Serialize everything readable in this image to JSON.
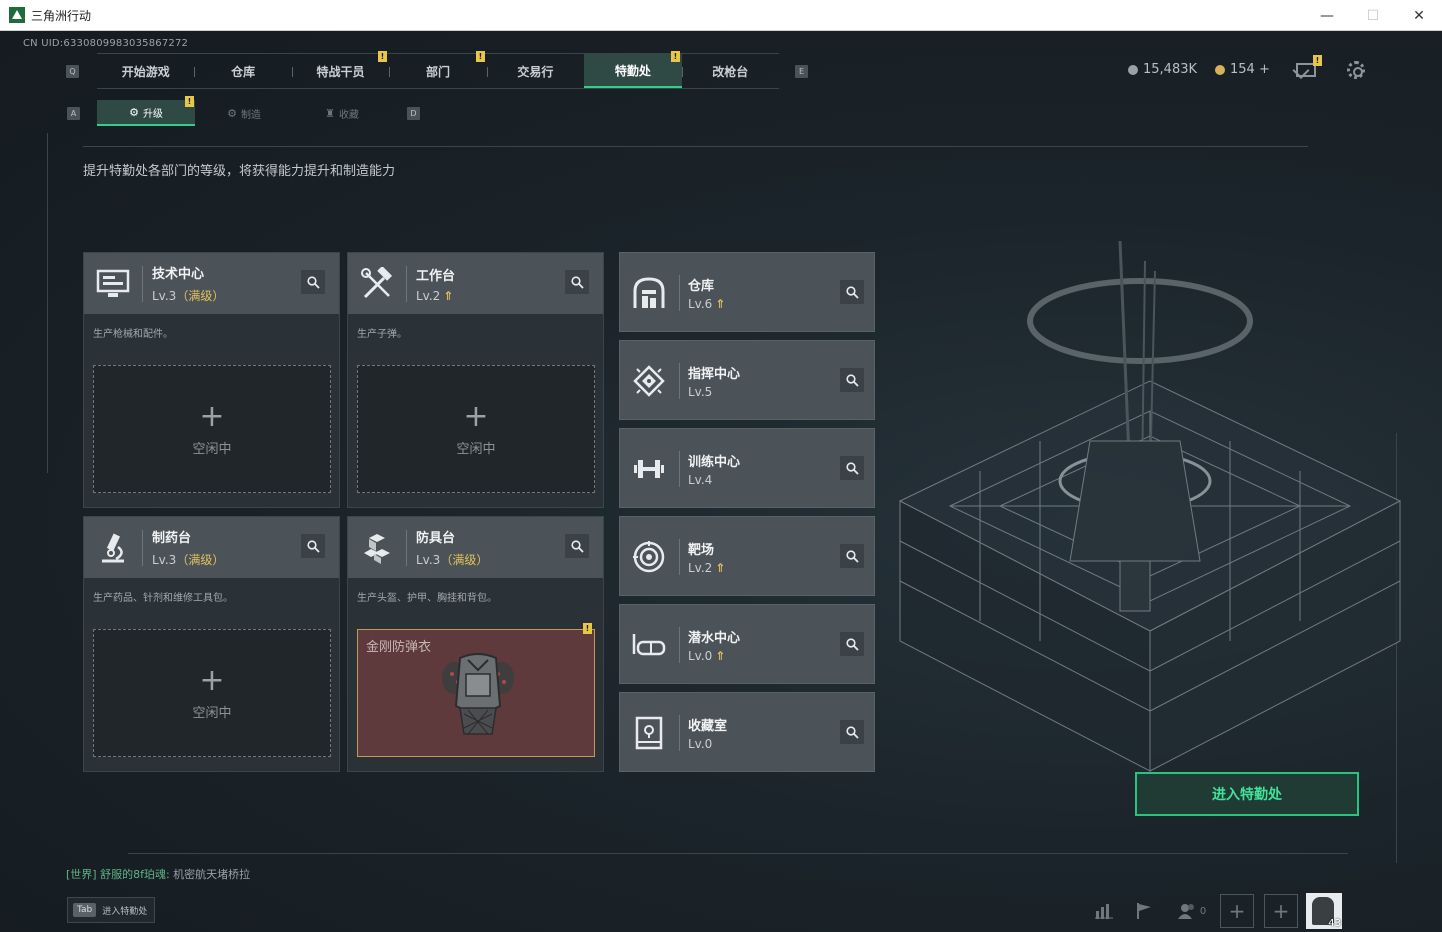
{
  "window": {
    "title": "三角洲行动",
    "minimize": "—",
    "maximize": "☐",
    "close": "✕"
  },
  "uid": "CN UID:6330809983035867272",
  "topnav": {
    "left_key": "Q",
    "right_key": "E",
    "tabs": [
      {
        "label": "开始游戏",
        "active": false,
        "badge": false
      },
      {
        "label": "仓库",
        "active": false,
        "badge": false
      },
      {
        "label": "特战干员",
        "active": false,
        "badge": true
      },
      {
        "label": "部门",
        "active": false,
        "badge": true
      },
      {
        "label": "交易行",
        "active": false,
        "badge": false
      },
      {
        "label": "特勤处",
        "active": true,
        "badge": true
      },
      {
        "label": "改枪台",
        "active": false,
        "badge": false
      }
    ]
  },
  "currency": {
    "silver": "15,483K",
    "gold": "154 +"
  },
  "badge_mark": "!",
  "subnav": {
    "left_key": "A",
    "right_key": "D",
    "tabs": [
      {
        "label": "升级",
        "icon": "⚙",
        "active": true
      },
      {
        "label": "制造",
        "icon": "⚙",
        "active": false
      },
      {
        "label": "收藏",
        "icon": "♜",
        "active": false
      }
    ]
  },
  "description": "提升特勤处各部门的等级，将获得能力提升和制造能力",
  "departments": [
    {
      "name": "技术中心",
      "level": "Lv.3",
      "maxed": "（满级）",
      "desc": "生产枪械和配件。",
      "slot_plus": "+",
      "slot_status": "空闲中"
    },
    {
      "name": "工作台",
      "level": "Lv.2",
      "upgrade": "⇑",
      "desc": "生产子弹。",
      "slot_plus": "+",
      "slot_status": "空闲中"
    },
    {
      "name": "制药台",
      "level": "Lv.3",
      "maxed": "（满级）",
      "desc": "生产药品、针剂和维修工具包。",
      "slot_plus": "+",
      "slot_status": "空闲中"
    },
    {
      "name": "防具台",
      "level": "Lv.3",
      "maxed": "（满级）",
      "desc": "生产头盔、护甲、胸挂和背包。",
      "item_name": "金刚防弹衣"
    }
  ],
  "right_departments": [
    {
      "name": "仓库",
      "level": "Lv.6",
      "upgrade": "⇑"
    },
    {
      "name": "指挥中心",
      "level": "Lv.5"
    },
    {
      "name": "训练中心",
      "level": "Lv.4"
    },
    {
      "name": "靶场",
      "level": "Lv.2",
      "upgrade": "⇑"
    },
    {
      "name": "潜水中心",
      "level": "Lv.0",
      "upgrade": "⇑"
    },
    {
      "name": "收藏室",
      "level": "Lv.0"
    }
  ],
  "enter_button": "进入特勤处",
  "chat": {
    "channel": "[世界]",
    "sender": "舒服的8f珀魂:",
    "message": "机密航天堵桥拉"
  },
  "tab_hint": {
    "key": "Tab",
    "label": "进入特勤处"
  },
  "bottom": {
    "friends_count": "0",
    "player_level": "43"
  }
}
